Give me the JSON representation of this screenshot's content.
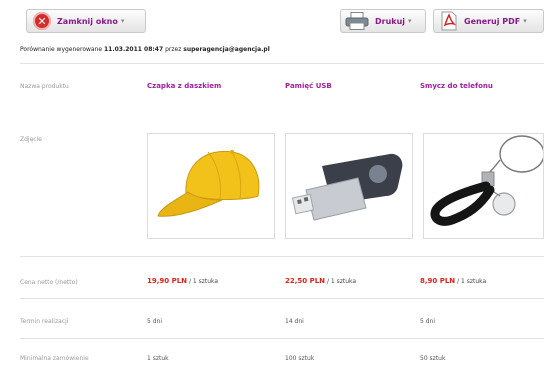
{
  "toolbar": {
    "close_label": "Zamknij okno",
    "print_label": "Drukuj",
    "pdf_label": "Generuj PDF",
    "caret": "▾"
  },
  "info": {
    "prefix": "Porównanie wygenerowane",
    "datetime": "11.03.2011 08:47",
    "mid": "przez",
    "email": "superagencja@agencja.pl"
  },
  "labels": {
    "product_name": "Nazwa produktu",
    "photo": "Zdjęcie",
    "price": "Cena netto (/netto)",
    "lead_time": "Termin realizacji",
    "min_order": "Minimalna zamówienie"
  },
  "products": [
    {
      "name": "Czapka z daszkiem",
      "price": "19,90 PLN",
      "per_unit": "/ 1 sztuka",
      "lead_time": "5 dni",
      "min_order": "1 sztuk",
      "photo_icon": "yellow-cap"
    },
    {
      "name": "Pamięć USB",
      "price": "22,50 PLN",
      "per_unit": "/ 1 sztuka",
      "lead_time": "14 dni",
      "min_order": "100 sztuk",
      "photo_icon": "usb-flash-drive"
    },
    {
      "name": "Smycz do telefonu",
      "price": "8,90 PLN",
      "per_unit": "/ 1 sztuka",
      "lead_time": "5 dni",
      "min_order": "50 sztuk",
      "photo_icon": "phone-lanyard"
    }
  ],
  "colors": {
    "accent": "#a020a0",
    "price": "#e0201a",
    "close_red": "#d42b2b",
    "cap_yellow": "#f2c21a"
  }
}
